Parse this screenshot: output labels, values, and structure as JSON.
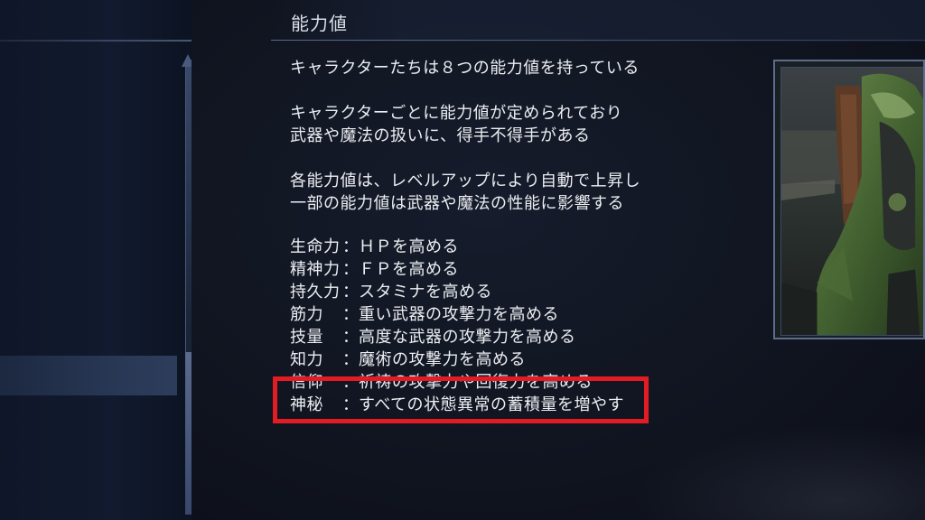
{
  "header": {
    "title": "能力値"
  },
  "intro": {
    "line1": "キャラクターたちは８つの能力値を持っている",
    "line2": "キャラクターごとに能力値が定められており",
    "line3": "武器や魔法の扱いに、得手不得手がある",
    "line4": "各能力値は、レベルアップにより自動で上昇し",
    "line5": "一部の能力値は武器や魔法の性能に影響する"
  },
  "stats": [
    {
      "name": "生命力",
      "colon": "：",
      "desc": "ＨＰを高める"
    },
    {
      "name": "精神力",
      "colon": "：",
      "desc": "ＦＰを高める"
    },
    {
      "name": "持久力",
      "colon": "：",
      "desc": "スタミナを高める"
    },
    {
      "name": "筋力",
      "colon": "：",
      "desc": "重い武器の攻撃力を高める"
    },
    {
      "name": "技量",
      "colon": "：",
      "desc": "高度な武器の攻撃力を高める"
    },
    {
      "name": "知力",
      "colon": "：",
      "desc": "魔術の攻撃力を高める"
    },
    {
      "name": "信仰",
      "colon": "：",
      "desc": "祈祷の攻撃力や回復力を高める"
    },
    {
      "name": "神秘",
      "colon": "：",
      "desc": "すべての状態異常の蓄積量を増やす"
    }
  ],
  "colors": {
    "highlight": "#e31b23",
    "text": "#eceef2",
    "frame": "#5b6c8e"
  },
  "preview": {
    "icon": "character-portrait"
  }
}
